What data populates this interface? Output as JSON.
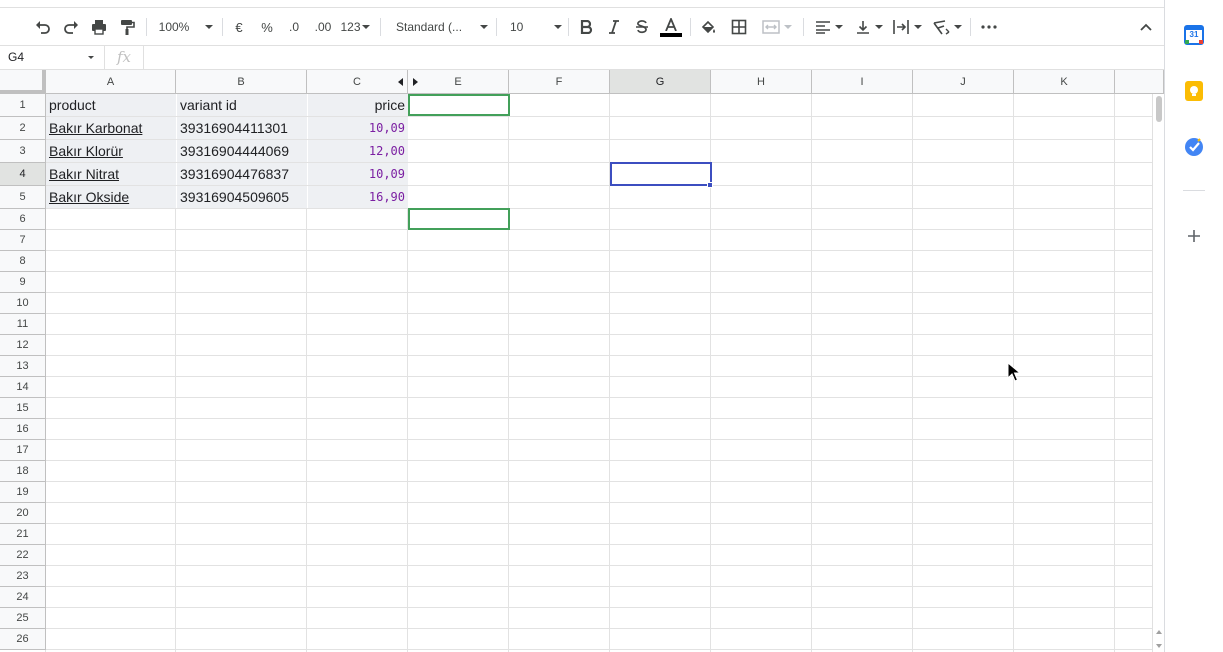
{
  "toolbar": {
    "zoom": "100%",
    "currency": "€",
    "percent": "%",
    "decrease_decimals": ".0",
    "increase_decimals": ".00",
    "more_formats": "123",
    "font_family": "Standard (...",
    "font_size": "10"
  },
  "formula_bar": {
    "cell_ref": "G4",
    "fx": "fx",
    "value": ""
  },
  "columns": [
    {
      "letter": "A"
    },
    {
      "letter": "B"
    },
    {
      "letter": "C"
    },
    {
      "letter": "E"
    },
    {
      "letter": "F"
    },
    {
      "letter": "G"
    },
    {
      "letter": "H"
    },
    {
      "letter": "I"
    },
    {
      "letter": "J"
    },
    {
      "letter": "K"
    }
  ],
  "rows": [
    "1",
    "2",
    "3",
    "4",
    "5",
    "6",
    "7",
    "8",
    "9",
    "10",
    "11",
    "12",
    "13",
    "14",
    "15",
    "16",
    "17",
    "18",
    "19",
    "20",
    "21",
    "22",
    "23",
    "24",
    "25",
    "26"
  ],
  "sheet": {
    "headers": {
      "product": "product",
      "variant_id": "variant id",
      "price": "price"
    },
    "records": [
      {
        "product": "Bakır Karbonat",
        "variant_id": "39316904411301",
        "price": "10,09"
      },
      {
        "product": "Bakır Klorür",
        "variant_id": "39316904444069",
        "price": "12,00"
      },
      {
        "product": "Bakır Nitrat",
        "variant_id": "39316904476837",
        "price": "10,09"
      },
      {
        "product": "Bakır Okside",
        "variant_id": "39316904509605",
        "price": "16,90"
      }
    ]
  },
  "selection": {
    "active_cell": "G4"
  },
  "side_panel": {
    "calendar_day": "31"
  },
  "colors": {
    "selection": "#3c4ec0",
    "highlight": "#43a05a",
    "number_text": "#7b1fa2"
  }
}
